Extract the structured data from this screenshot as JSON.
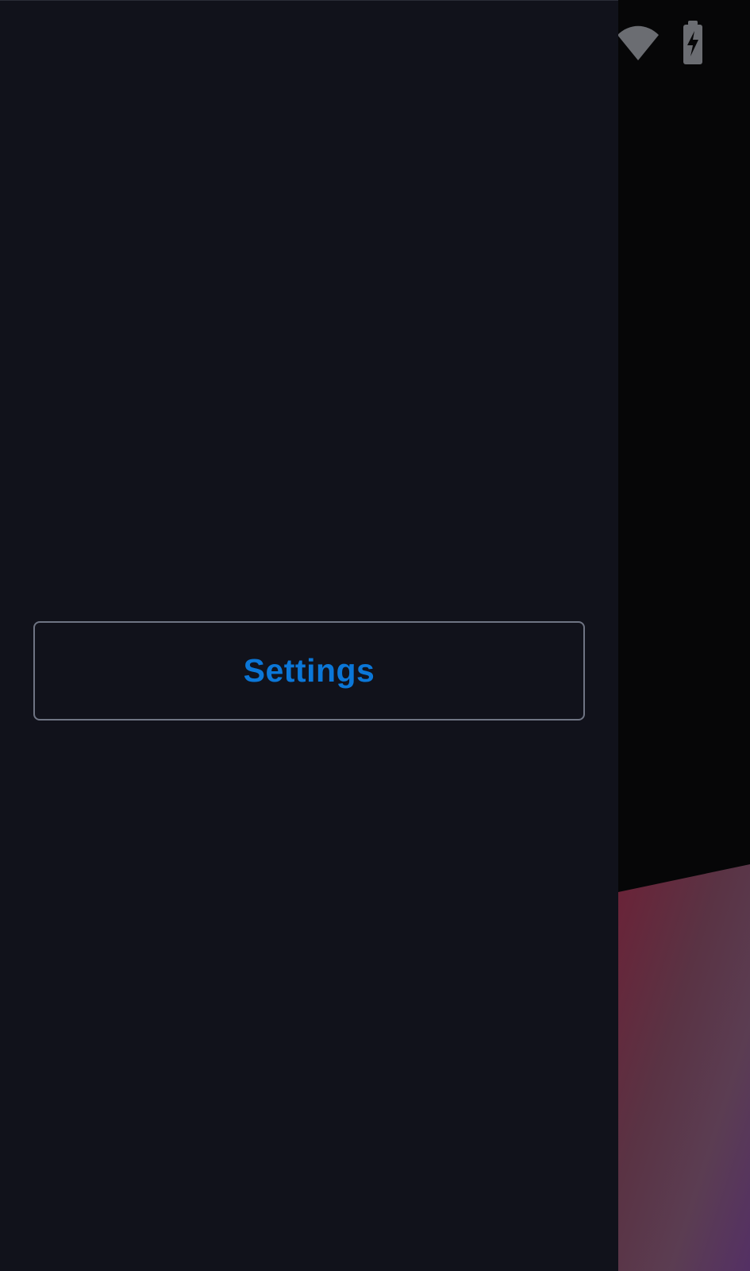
{
  "drawer": {
    "settings_button_label": "Settings"
  },
  "status_bar": {
    "icons": [
      "wifi-icon",
      "battery-charging-icon"
    ]
  },
  "colors": {
    "drawer_background": "#11121b",
    "button_border": "#6f7483",
    "button_text": "#0b77d8",
    "status_icon": "#6b6d72"
  }
}
